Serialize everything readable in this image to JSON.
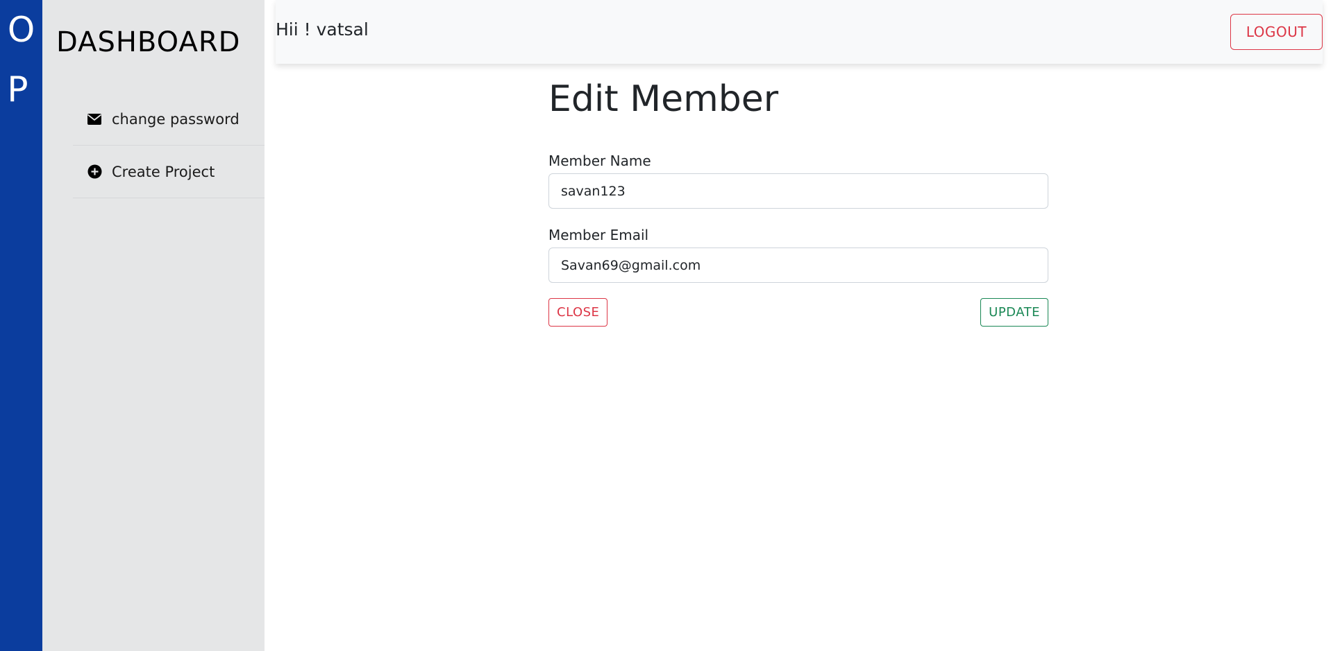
{
  "brand": {
    "rail_letters": [
      "O",
      "P"
    ],
    "rail_color": "#0b3d9e"
  },
  "sidebar": {
    "title": "DASHBOARD",
    "items": [
      {
        "label": "change password",
        "icon": "envelope-icon"
      },
      {
        "label": "Create Project",
        "icon": "plus-circle-icon"
      }
    ]
  },
  "header": {
    "greeting": "Hii ! vatsal",
    "logout_label": "LOGOUT"
  },
  "form": {
    "title": "Edit Member",
    "name_label": "Member Name",
    "name_value": "savan123",
    "email_label": "Member Email",
    "email_value": "Savan69@gmail.com",
    "close_label": "CLOSE",
    "update_label": "UPDATE"
  },
  "colors": {
    "danger": "#dc3545",
    "success": "#198754",
    "sidebar_bg": "#e5e6e7",
    "topbar_bg": "#f8f9fa"
  }
}
